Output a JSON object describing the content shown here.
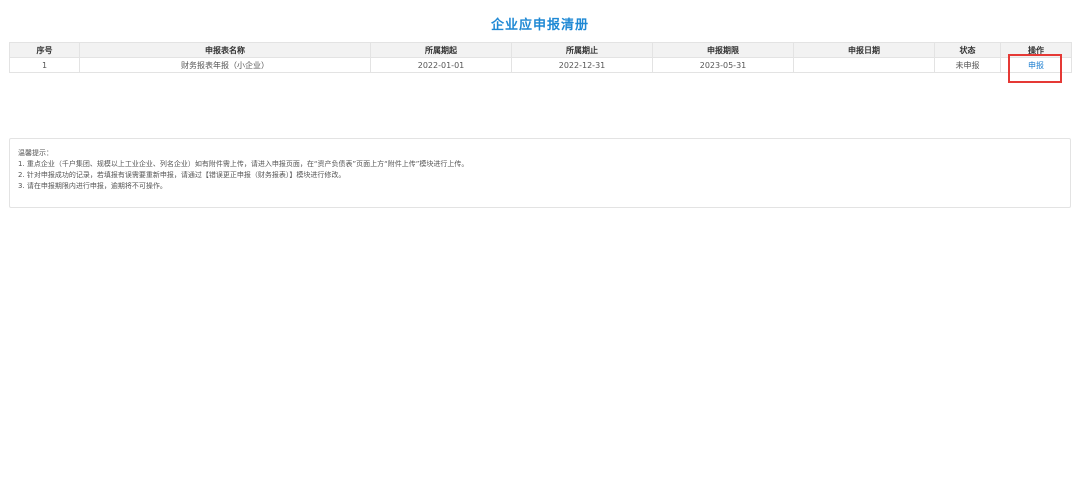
{
  "page": {
    "title": "企业应申报清册"
  },
  "table": {
    "headers": [
      "序号",
      "申报表名称",
      "所属期起",
      "所属期止",
      "申报期限",
      "申报日期",
      "状态",
      "操作"
    ],
    "rows": [
      {
        "index": "1",
        "name": "财务报表年报（小企业）",
        "period_start": "2022-01-01",
        "period_end": "2022-12-31",
        "deadline": "2023-05-31",
        "declare_date": "",
        "status": "未申报",
        "action": "申报"
      }
    ]
  },
  "tips": {
    "title": "温馨提示：",
    "items": [
      "1. 重点企业（千户集团、规模以上工业企业、列名企业）如有附件需上传，请进入申报页面，在“资产负债表”页面上方“附件上传”模块进行上传。",
      "2. 针对申报成功的记录，若填报有误需要重新申报，请通过【错误更正申报（财务报表）】模块进行修改。",
      "3. 请在申报期限内进行申报，逾期将不可操作。"
    ]
  },
  "colors": {
    "title": "#1e88d4",
    "link": "#1e7fd0",
    "highlight": "#e53935",
    "header_bg": "#f2f2f2",
    "border": "#e3e3e3"
  }
}
